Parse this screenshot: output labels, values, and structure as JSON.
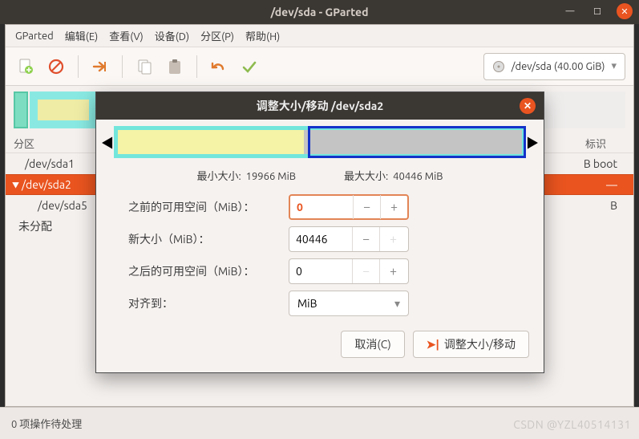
{
  "window": {
    "title": "/dev/sda - GParted"
  },
  "menus": {
    "gparted": "GParted",
    "edit": "编辑(E)",
    "view": "查看(V)",
    "device": "设备(D)",
    "partition": "分区(P)",
    "help": "帮助(H)"
  },
  "device_selector": {
    "label": "/dev/sda  (40.00 GiB)"
  },
  "icons": {
    "new": "new-icon",
    "delete": "delete-icon",
    "resize": "resize-icon",
    "copy": "copy-icon",
    "paste": "paste-icon",
    "undo": "undo-icon",
    "apply": "apply-icon"
  },
  "columns": {
    "partition": "分区",
    "flags": "标识"
  },
  "partitions": {
    "row0": {
      "name": "/dev/sda1",
      "flags_b": "B  boot"
    },
    "row1": {
      "name": "/dev/sda2"
    },
    "row2": {
      "name": "/dev/sda5",
      "flags_b": "B"
    },
    "row3": {
      "name": "未分配"
    }
  },
  "dialog": {
    "title": "调整大小/移动 /dev/sda2",
    "min_label": "最小大小:",
    "min_value": "19966 MiB",
    "max_label": "最大大小:",
    "max_value": "40446 MiB",
    "fields": {
      "free_before": {
        "label": "之前的可用空间（MiB）：",
        "value": "0"
      },
      "new_size": {
        "label": "新大小（MiB）：",
        "value": "40446"
      },
      "free_after": {
        "label": "之后的可用空间（MiB）：",
        "value": "0"
      },
      "align": {
        "label": "对齐到：",
        "value": "MiB"
      }
    },
    "buttons": {
      "cancel": "取消(C)",
      "resize": "调整大小/移动"
    }
  },
  "statusbar": {
    "pending": "0 项操作待处理"
  },
  "watermark": "CSDN @YZL40514131"
}
